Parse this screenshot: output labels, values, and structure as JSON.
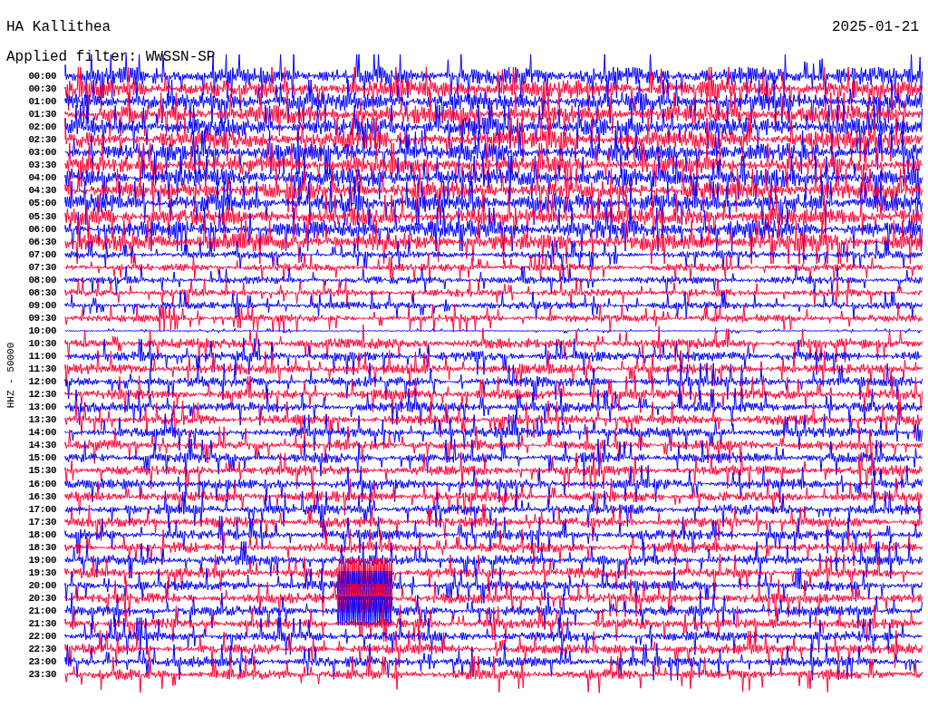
{
  "station": {
    "title": "HA Kallithea",
    "date": "2025-01-21",
    "filter": "Applied filter: WWSSN-SP"
  },
  "axis_label": "HHZ - 50000",
  "rows": [
    {
      "time": "00:00",
      "color": "#0000ff"
    },
    {
      "time": "00:30",
      "color": "#ff0033"
    },
    {
      "time": "01:00",
      "color": "#0000ff"
    },
    {
      "time": "01:30",
      "color": "#ff0033"
    },
    {
      "time": "02:00",
      "color": "#0000ff"
    },
    {
      "time": "02:30",
      "color": "#ff0033"
    },
    {
      "time": "03:00",
      "color": "#0000ff"
    },
    {
      "time": "03:30",
      "color": "#ff0033"
    },
    {
      "time": "04:00",
      "color": "#0000ff"
    },
    {
      "time": "04:30",
      "color": "#ff0033"
    },
    {
      "time": "05:00",
      "color": "#0000ff"
    },
    {
      "time": "05:30",
      "color": "#ff0033"
    },
    {
      "time": "06:00",
      "color": "#0000ff"
    },
    {
      "time": "06:30",
      "color": "#ff0033"
    },
    {
      "time": "07:00",
      "color": "#0000ff"
    },
    {
      "time": "07:30",
      "color": "#ff0033"
    },
    {
      "time": "08:00",
      "color": "#0000ff"
    },
    {
      "time": "08:30",
      "color": "#ff0033"
    },
    {
      "time": "09:00",
      "color": "#0000ff"
    },
    {
      "time": "09:30",
      "color": "#ff0033"
    },
    {
      "time": "10:00",
      "color": "#0000ff"
    },
    {
      "time": "10:30",
      "color": "#ff0033"
    },
    {
      "time": "11:00",
      "color": "#0000ff"
    },
    {
      "time": "11:30",
      "color": "#ff0033"
    },
    {
      "time": "12:00",
      "color": "#0000ff"
    },
    {
      "time": "12:30",
      "color": "#ff0033"
    },
    {
      "time": "13:00",
      "color": "#0000ff"
    },
    {
      "time": "13:30",
      "color": "#ff0033"
    },
    {
      "time": "14:00",
      "color": "#0000ff"
    },
    {
      "time": "14:30",
      "color": "#ff0033"
    },
    {
      "time": "15:00",
      "color": "#0000ff"
    },
    {
      "time": "15:30",
      "color": "#ff0033"
    },
    {
      "time": "16:00",
      "color": "#0000ff"
    },
    {
      "time": "16:30",
      "color": "#ff0033"
    },
    {
      "time": "17:00",
      "color": "#0000ff"
    },
    {
      "time": "17:30",
      "color": "#ff0033"
    },
    {
      "time": "18:00",
      "color": "#0000ff"
    },
    {
      "time": "18:30",
      "color": "#ff0033"
    },
    {
      "time": "19:00",
      "color": "#0000ff"
    },
    {
      "time": "19:30",
      "color": "#ff0033"
    },
    {
      "time": "20:00",
      "color": "#0000ff"
    },
    {
      "time": "20:30",
      "color": "#ff0033"
    },
    {
      "time": "21:00",
      "color": "#0000ff"
    },
    {
      "time": "21:30",
      "color": "#ff0033"
    },
    {
      "time": "22:00",
      "color": "#0000ff"
    },
    {
      "time": "22:30",
      "color": "#ff0033"
    },
    {
      "time": "23:00",
      "color": "#0000ff"
    },
    {
      "time": "23:30",
      "color": "#ff0033"
    }
  ]
}
